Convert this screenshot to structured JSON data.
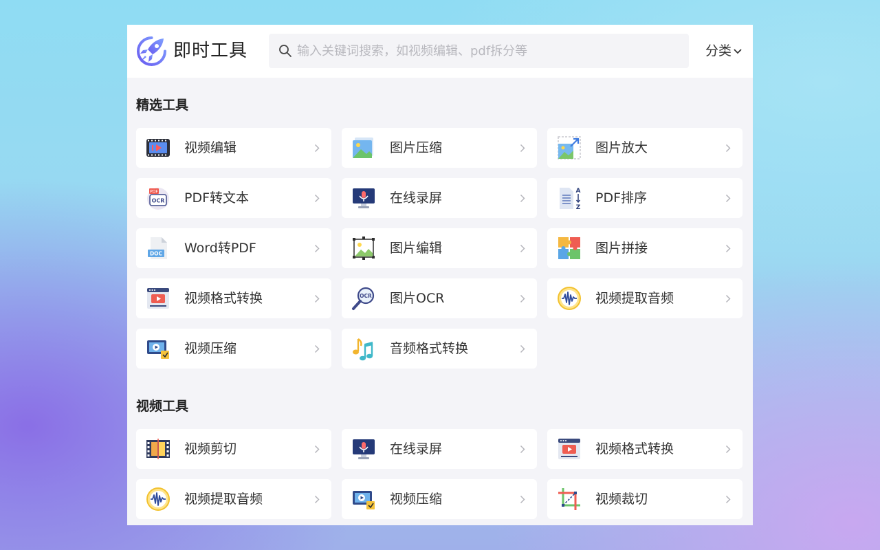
{
  "header": {
    "app_title": "即时工具",
    "search_placeholder": "输入关键词搜索，如视频编辑、pdf拆分等",
    "search_value": "",
    "category_label": "分类"
  },
  "sections": [
    {
      "title": "精选工具",
      "tools": [
        {
          "label": "视频编辑",
          "icon": "video-edit-icon"
        },
        {
          "label": "图片压缩",
          "icon": "image-compress-icon"
        },
        {
          "label": "图片放大",
          "icon": "image-enlarge-icon"
        },
        {
          "label": "PDF转文本",
          "icon": "pdf-ocr-icon"
        },
        {
          "label": "在线录屏",
          "icon": "screen-record-icon"
        },
        {
          "label": "PDF排序",
          "icon": "pdf-sort-icon"
        },
        {
          "label": "Word转PDF",
          "icon": "doc-file-icon"
        },
        {
          "label": "图片编辑",
          "icon": "image-edit-icon"
        },
        {
          "label": "图片拼接",
          "icon": "puzzle-icon"
        },
        {
          "label": "视频格式转换",
          "icon": "video-convert-icon"
        },
        {
          "label": "图片OCR",
          "icon": "ocr-magnifier-icon"
        },
        {
          "label": "视频提取音频",
          "icon": "audio-wave-icon"
        },
        {
          "label": "视频压缩",
          "icon": "video-compress-icon"
        },
        {
          "label": "音频格式转换",
          "icon": "music-notes-icon"
        }
      ]
    },
    {
      "title": "视频工具",
      "tools": [
        {
          "label": "视频剪切",
          "icon": "film-strip-icon"
        },
        {
          "label": "在线录屏",
          "icon": "screen-record-icon"
        },
        {
          "label": "视频格式转换",
          "icon": "video-convert-icon"
        },
        {
          "label": "视频提取音频",
          "icon": "audio-wave-icon"
        },
        {
          "label": "视频压缩",
          "icon": "video-compress-icon"
        },
        {
          "label": "视频裁切",
          "icon": "crop-icon"
        }
      ]
    }
  ]
}
